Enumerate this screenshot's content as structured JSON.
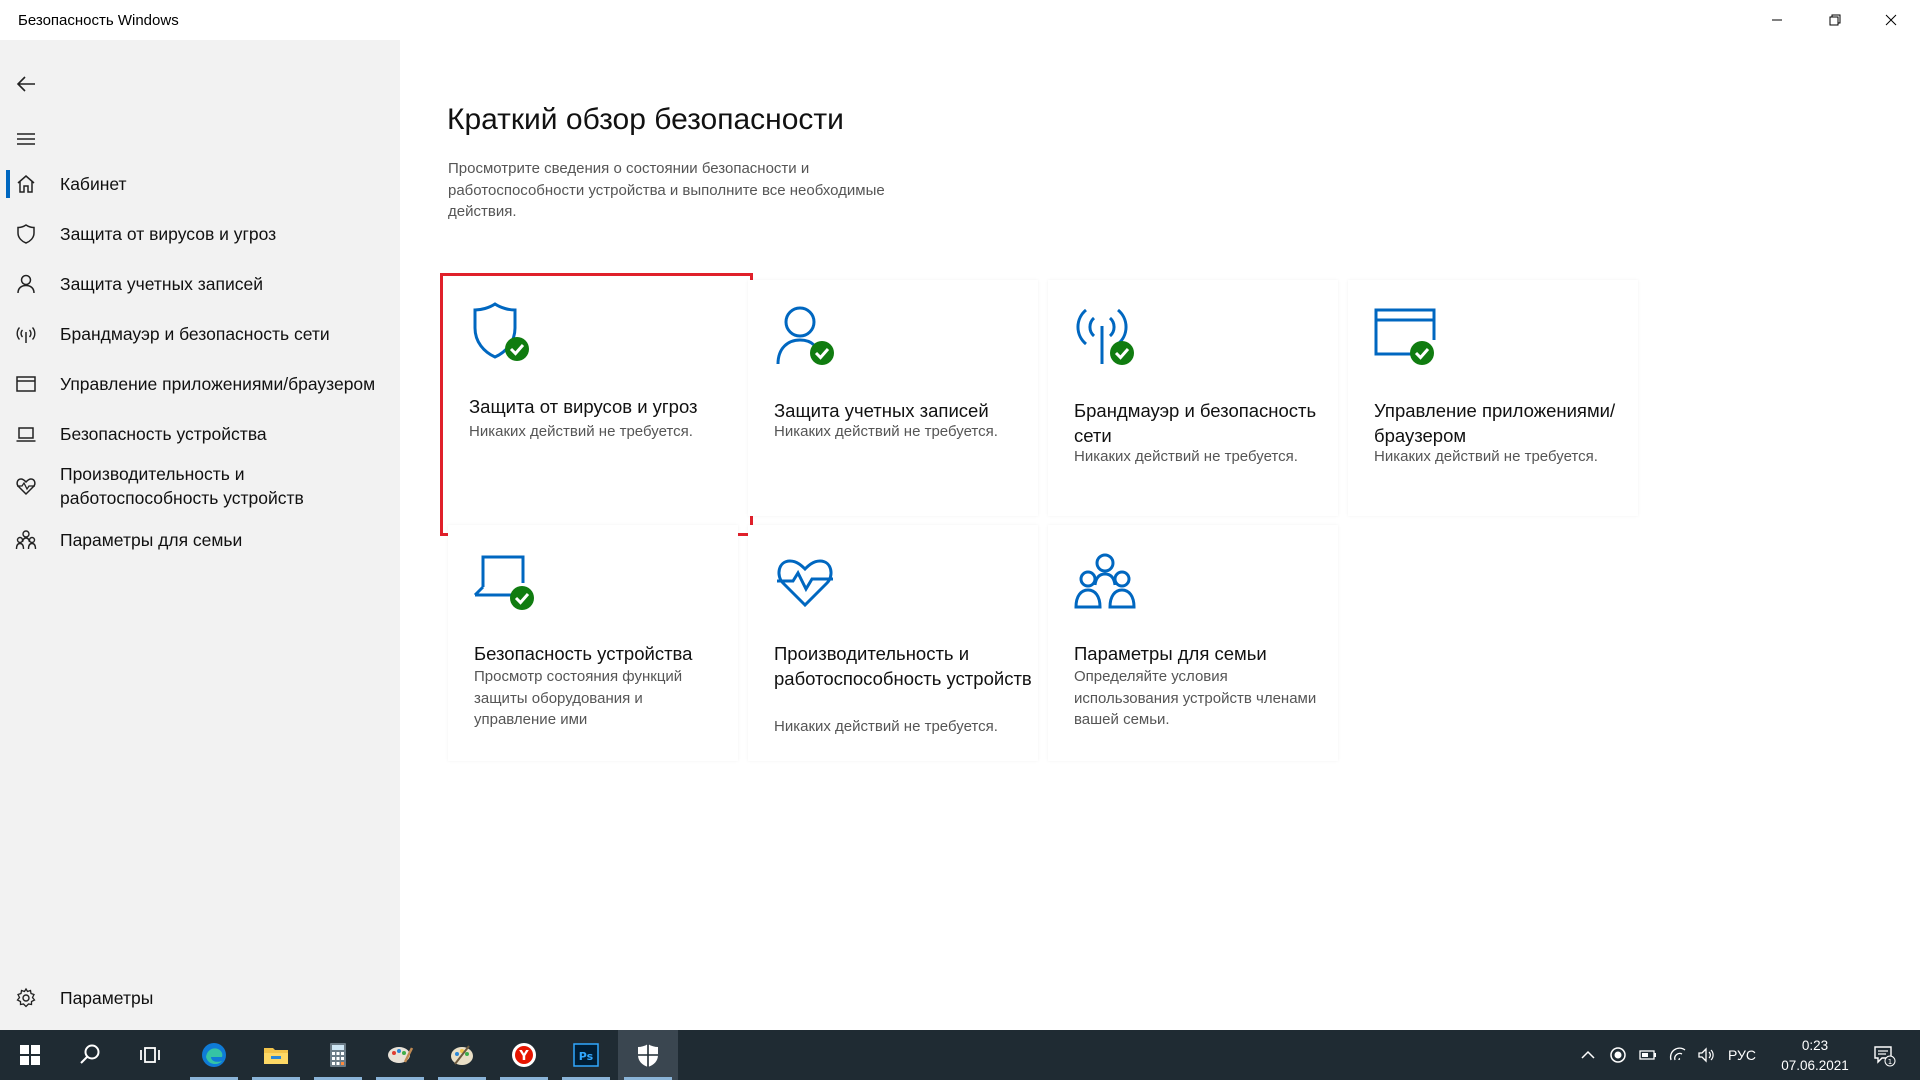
{
  "window": {
    "title": "Безопасность Windows"
  },
  "sidebar": {
    "items": [
      {
        "label": "Кабинет",
        "icon": "home-icon",
        "active": true
      },
      {
        "label": "Защита от вирусов и угроз",
        "icon": "shield-icon"
      },
      {
        "label": "Защита учетных записей",
        "icon": "person-icon"
      },
      {
        "label": "Брандмауэр и безопасность сети",
        "icon": "wifi-antenna-icon"
      },
      {
        "label": "Управление приложениями/браузером",
        "icon": "app-window-icon"
      },
      {
        "label": "Безопасность устройства",
        "icon": "laptop-icon"
      },
      {
        "label": "Производительность и работоспособность устройств",
        "icon": "heart-pulse-icon"
      },
      {
        "label": "Параметры для семьи",
        "icon": "family-icon"
      }
    ],
    "settings_label": "Параметры"
  },
  "main": {
    "title": "Краткий обзор безопасности",
    "description": "Просмотрите сведения о состоянии безопасности и работоспособности устройства и выполните все необходимые действия.",
    "cards": [
      {
        "title": "Защита от вирусов и угроз",
        "desc": "Никаких действий не требуется.",
        "icon": "shield-check-icon",
        "highlighted": true
      },
      {
        "title": "Защита учетных записей",
        "desc": "Никаких действий не требуется.",
        "icon": "person-check-icon"
      },
      {
        "title": "Брандмауэр и безопасность сети",
        "desc": "Никаких действий не требуется.",
        "icon": "antenna-check-icon"
      },
      {
        "title": "Управление приложениями/браузером",
        "desc": "Никаких действий не требуется.",
        "icon": "window-check-icon"
      },
      {
        "title": "Безопасность устройства",
        "desc": "Просмотр состояния функций защиты оборудования и управление ими",
        "icon": "laptop-check-icon"
      },
      {
        "title": "Производительность и работоспособность устройств",
        "desc": "Никаких действий не требуется.",
        "icon": "heart-pulse-icon"
      },
      {
        "title": "Параметры для семьи",
        "desc": "Определяйте условия использования устройств членами вашей семьи.",
        "icon": "family-icon"
      }
    ]
  },
  "taskbar": {
    "apps": [
      "start-icon",
      "search-icon",
      "task-view-icon",
      "edge-icon",
      "file-explorer-icon",
      "calculator-icon",
      "paint-icon",
      "paint-palette-icon",
      "yandex-browser-icon",
      "photoshop-icon",
      "windows-security-icon"
    ],
    "photoshop_label": "Ps",
    "yandex_label": "Y",
    "language": "РУС",
    "time": "0:23",
    "date": "07.06.2021",
    "notification_count": "1"
  },
  "colors": {
    "accent": "#0067c0",
    "check_green": "#107c10",
    "highlight_red": "#e0202a",
    "sidebar_bg": "#f2f2f2",
    "taskbar_bg": "#1f2b33"
  }
}
